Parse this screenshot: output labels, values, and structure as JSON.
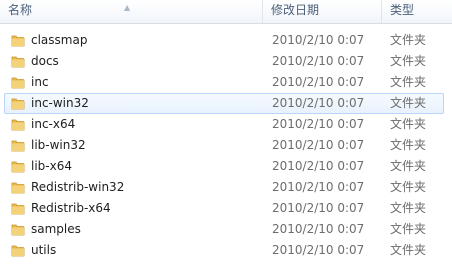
{
  "header": {
    "name_label": "名称",
    "date_label": "修改日期",
    "type_label": "类型"
  },
  "rows": [
    {
      "name": "classmap",
      "date": "2010/2/10 0:07",
      "type": "文件夹"
    },
    {
      "name": "docs",
      "date": "2010/2/10 0:07",
      "type": "文件夹"
    },
    {
      "name": "inc",
      "date": "2010/2/10 0:07",
      "type": "文件夹"
    },
    {
      "name": "inc-win32",
      "date": "2010/2/10 0:07",
      "type": "文件夹"
    },
    {
      "name": "inc-x64",
      "date": "2010/2/10 0:07",
      "type": "文件夹"
    },
    {
      "name": "lib-win32",
      "date": "2010/2/10 0:07",
      "type": "文件夹"
    },
    {
      "name": "lib-x64",
      "date": "2010/2/10 0:07",
      "type": "文件夹"
    },
    {
      "name": "Redistrib-win32",
      "date": "2010/2/10 0:07",
      "type": "文件夹"
    },
    {
      "name": "Redistrib-x64",
      "date": "2010/2/10 0:07",
      "type": "文件夹"
    },
    {
      "name": "samples",
      "date": "2010/2/10 0:07",
      "type": "文件夹"
    },
    {
      "name": "utils",
      "date": "2010/2/10 0:07",
      "type": "文件夹"
    }
  ],
  "icons": {
    "folder": "folder-icon",
    "sort": "sort-arrow-icon"
  },
  "colors": {
    "folder": "#e8b94a",
    "hover_border": "#b9d7fc",
    "header_text": "#4c607a"
  }
}
